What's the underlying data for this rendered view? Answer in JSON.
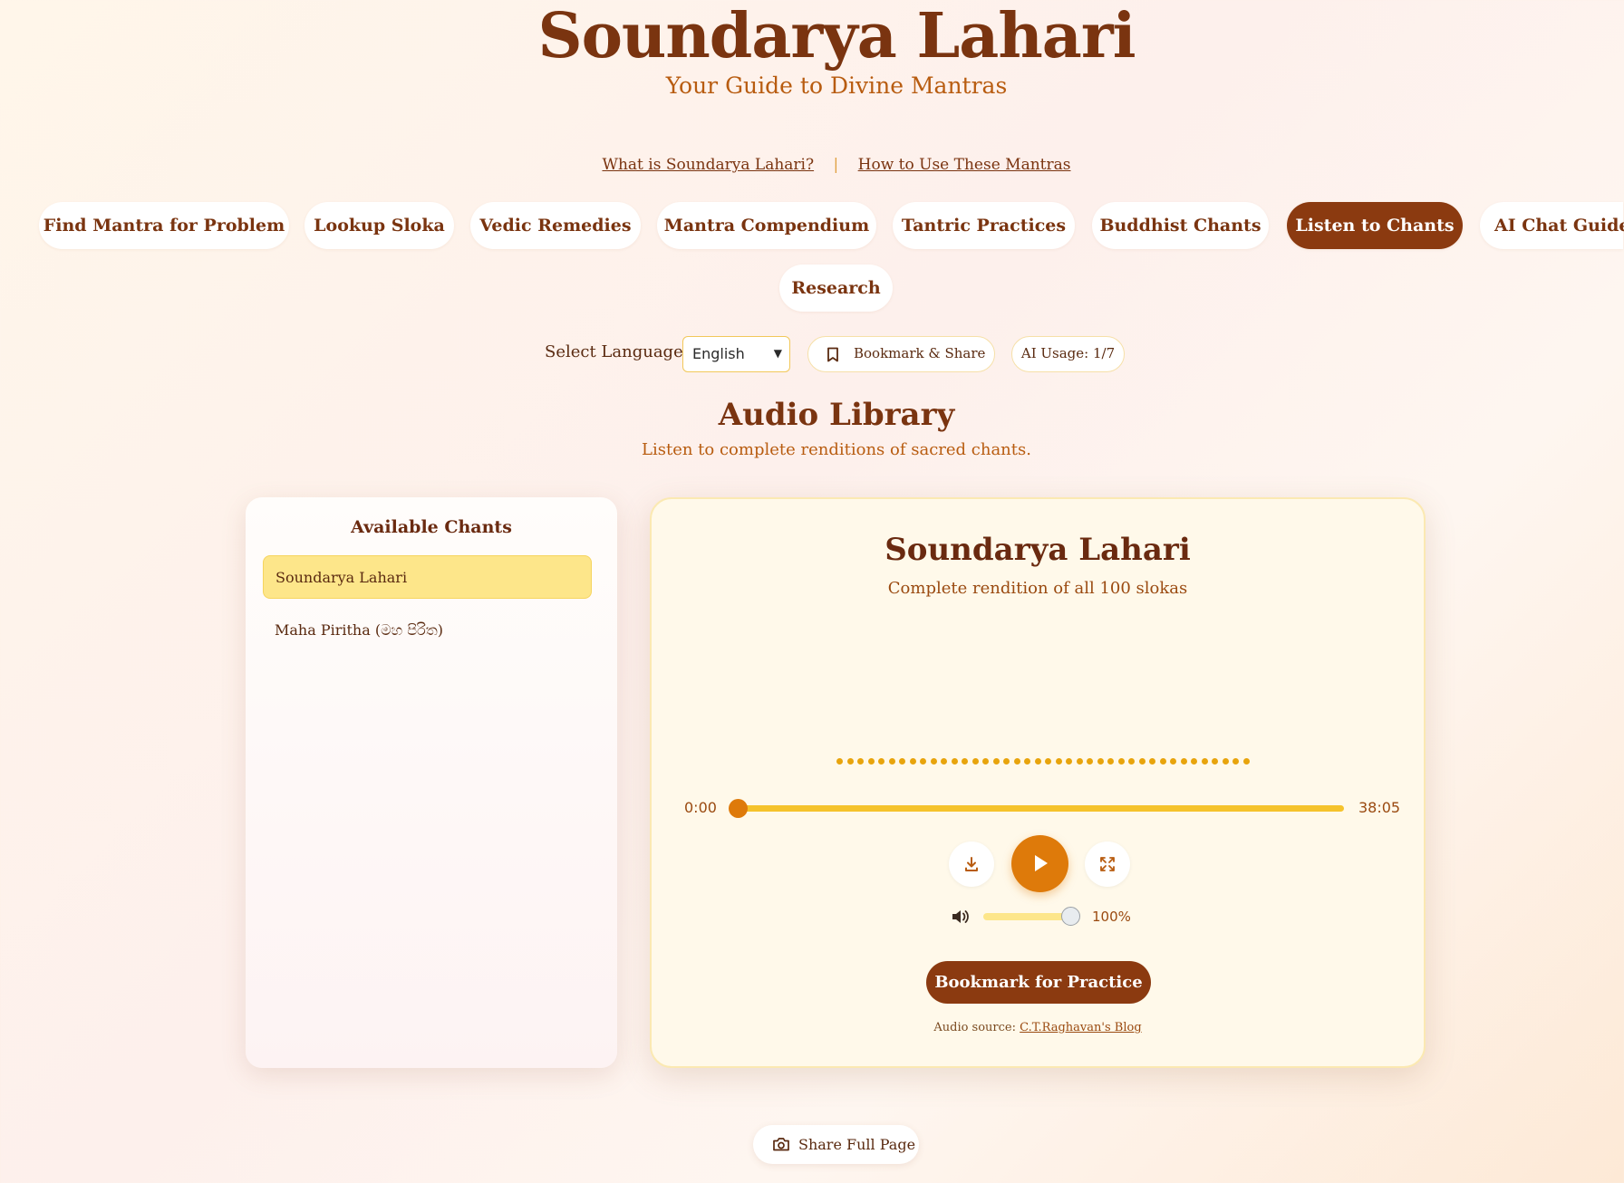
{
  "header": {
    "title": "Soundarya Lahari",
    "subtitle": "Your Guide to Divine Mantras"
  },
  "info_links": {
    "what_is": "What is Soundarya Lahari?",
    "separator": "|",
    "how_to": "How to Use These Mantras"
  },
  "tabs": [
    {
      "label": "Find Mantra for Problem"
    },
    {
      "label": "Lookup Sloka"
    },
    {
      "label": "Vedic Remedies"
    },
    {
      "label": "Mantra Compendium"
    },
    {
      "label": "Tantric Practices"
    },
    {
      "label": "Buddhist Chants"
    },
    {
      "label": "Listen to Chants",
      "active": true
    },
    {
      "label": "AI Chat Guide"
    },
    {
      "label": "Research"
    }
  ],
  "controls": {
    "language_label": "Select Language:",
    "language_value": "English",
    "bookmark_share": "Bookmark & Share",
    "ai_usage": "AI Usage: 1/7"
  },
  "section": {
    "title": "Audio Library",
    "subtitle": "Listen to complete renditions of sacred chants."
  },
  "chants_panel": {
    "heading": "Available Chants",
    "items": [
      {
        "label": "Soundarya Lahari",
        "selected": true
      },
      {
        "label": "Maha Piritha (මහ පිරිත)",
        "selected": false
      }
    ]
  },
  "player": {
    "title": "Soundarya Lahari",
    "description": "Complete rendition of all 100 slokas",
    "current_time": "0:00",
    "duration": "38:05",
    "progress_fraction": 0,
    "volume_label": "100%",
    "volume_fraction": 1.0,
    "bookmark_button": "Bookmark for Practice",
    "source_prefix": "Audio source:",
    "source_link": "C.T.Raghavan's Blog",
    "icons": [
      "download-icon",
      "play-icon",
      "fullscreen-icon",
      "volume-icon"
    ]
  },
  "footer": {
    "share_button": "Share Full Page"
  },
  "colors": {
    "brand_brown": "#8b3a10",
    "accent_orange": "#de7a0a",
    "progress_gold": "#f5c32c",
    "selected_yellow": "#fde68a"
  }
}
